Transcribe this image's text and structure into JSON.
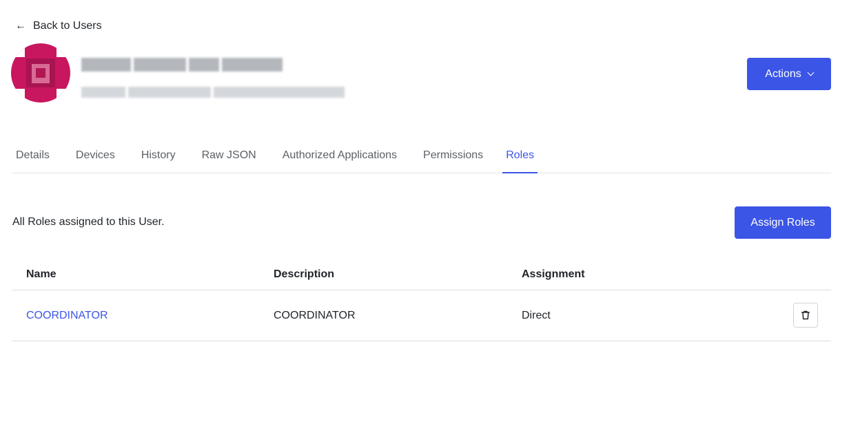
{
  "header": {
    "back_label": "Back to Users",
    "back_icon": "arrow-left-icon",
    "avatar_color": "#c8165f",
    "actions_label": "Actions"
  },
  "tabs": [
    {
      "label": "Details",
      "active": false
    },
    {
      "label": "Devices",
      "active": false
    },
    {
      "label": "History",
      "active": false
    },
    {
      "label": "Raw JSON",
      "active": false
    },
    {
      "label": "Authorized Applications",
      "active": false
    },
    {
      "label": "Permissions",
      "active": false
    },
    {
      "label": "Roles",
      "active": true
    }
  ],
  "roles": {
    "description": "All Roles assigned to this User.",
    "assign_label": "Assign Roles",
    "columns": [
      "Name",
      "Description",
      "Assignment"
    ],
    "rows": [
      {
        "name": "COORDINATOR",
        "description": "COORDINATOR",
        "assignment": "Direct"
      }
    ]
  },
  "colors": {
    "accent": "#3b55e6",
    "text": "#1f2328",
    "muted": "#5b6168",
    "border": "#d9dce0"
  }
}
